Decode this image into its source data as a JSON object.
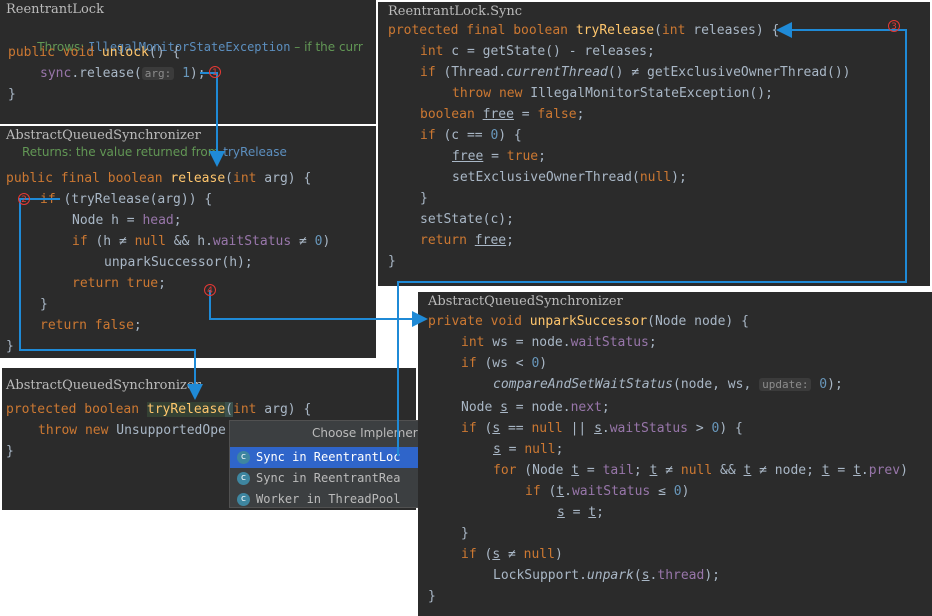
{
  "panels": {
    "unlock": {
      "title": "ReentrantLock",
      "doc": "Throws: IllegalMonitorStateException – if the curr",
      "doc_prefix": "Throws: ",
      "doc_link": "IllegalMonitorStateException",
      "doc_suffix": " – if the curr",
      "sig_kw": "public void ",
      "sig_fn": "unlock",
      "sig_rest": "() {",
      "call_obj": "sync",
      "call_rest": ".release(",
      "hint": "arg:",
      "arg": " 1",
      "call_end": ");",
      "close": "}"
    },
    "release": {
      "title": "AbstractQueuedSynchronizer",
      "doc_text": "Returns: the value returned from ",
      "doc_link": "tryRelease",
      "sig_kw": "public final boolean ",
      "sig_fn": "release",
      "sig_open": "(",
      "sig_type": "int",
      "sig_rest": " arg) {",
      "l1_kw": "if",
      "l1_rest": " (tryRelease(arg)) {",
      "l2": "Node h = ",
      "l2_fld": "head",
      "l2_end": ";",
      "l3_kw": "if",
      "l3_a": " (h ≠ ",
      "l3_null": "null",
      "l3_b": " && h.",
      "l3_fld": "waitStatus",
      "l3_c": " ≠ ",
      "l3_num": "0",
      "l3_d": ")",
      "l4": "unparkSuccessor(h);",
      "l5_kw": "return true",
      "l5_end": ";",
      "l6": "}",
      "l7_kw": "return false",
      "l7_end": ";",
      "close": "}"
    },
    "tryrelease_abs": {
      "title": "AbstractQueuedSynchronizer",
      "sig_kw": "protected boolean ",
      "sig_fn": "tryRelease",
      "sig_open": "(",
      "sig_type": "int",
      "sig_rest": " arg) {",
      "l1_kw": "throw new ",
      "l1_rest": "UnsupportedOpe",
      "close": "}"
    },
    "sync": {
      "title": "ReentrantLock.Sync",
      "sig_kw": "protected final boolean ",
      "sig_fn": "tryRelease",
      "sig_open": "(",
      "sig_type": "int",
      "sig_rest": " releases) {",
      "l1_kw": "int",
      "l1_rest": " c = getState() - releases;",
      "l2_kw": "if",
      "l2_a": " (Thread.",
      "l2_it": "currentThread",
      "l2_b": "() ≠ getExclusiveOwnerThread())",
      "l3_kw": "throw new ",
      "l3_rest": "IllegalMonitorStateException();",
      "l4_kw": "boolean ",
      "l4_var": "free",
      "l4_a": " = ",
      "l4_kw2": "false",
      "l4_end": ";",
      "l5_kw": "if",
      "l5_a": " (c ",
      "l5_op": "==",
      "l5_b": " ",
      "l5_num": "0",
      "l5_c": ") {",
      "l6_var": "free",
      "l6_a": " = ",
      "l6_kw": "true",
      "l6_end": ";",
      "l7": "setExclusiveOwnerThread(",
      "l7_kw": "null",
      "l7_end": ");",
      "l8": "}",
      "l9": "setState(c);",
      "l10_kw": "return ",
      "l10_var": "free",
      "l10_end": ";",
      "close": "}"
    },
    "unpark": {
      "title": "AbstractQueuedSynchronizer",
      "sig_kw": "private void ",
      "sig_fn": "unparkSuccessor",
      "sig_rest": "(Node node) {",
      "l1_kw": "int",
      "l1_a": " ws = node.",
      "l1_fld": "waitStatus",
      "l1_end": ";",
      "l2_kw": "if",
      "l2_a": " (ws < ",
      "l2_num": "0",
      "l2_end": ")",
      "l3_it": "compareAndSetWaitStatus",
      "l3_a": "(node, ws, ",
      "l3_hint": "update:",
      "l3_num": " 0",
      "l3_end": ");",
      "l4_a": "Node ",
      "l4_var": "s",
      "l4_b": " = node.",
      "l4_fld": "next",
      "l4_end": ";",
      "l5_kw": "if",
      "l5_a": " (",
      "l5_var": "s",
      "l5_b": " == ",
      "l5_null": "null",
      "l5_c": " || ",
      "l5_var2": "s",
      "l5_d": ".",
      "l5_fld": "waitStatus",
      "l5_e": " > ",
      "l5_num": "0",
      "l5_f": ") {",
      "l6_var": "s",
      "l6_a": " = ",
      "l6_kw": "null",
      "l6_end": ";",
      "l7_kw": "for",
      "l7_a": " (Node ",
      "l7_t1": "t",
      "l7_b": " = ",
      "l7_fld": "tail",
      "l7_c": "; ",
      "l7_t2": "t",
      "l7_d": " ≠ ",
      "l7_null": "null",
      "l7_e": " && ",
      "l7_t3": "t",
      "l7_f": " ≠ node; ",
      "l7_t4": "t",
      "l7_g": " = ",
      "l7_t5": "t",
      "l7_h": ".",
      "l7_fld2": "prev",
      "l7_i": ")",
      "l8_kw": "if",
      "l8_a": " (",
      "l8_t": "t",
      "l8_b": ".",
      "l8_fld": "waitStatus",
      "l8_c": " ≤ ",
      "l8_num": "0",
      "l8_d": ")",
      "l9_s": "s",
      "l9_a": " = ",
      "l9_t": "t",
      "l9_end": ";",
      "l10": "}",
      "l11_kw": "if",
      "l11_a": " (",
      "l11_s": "s",
      "l11_b": " ≠ ",
      "l11_null": "null",
      "l11_c": ")",
      "l12_a": "LockSupport.",
      "l12_it": "unpark",
      "l12_b": "(",
      "l12_s": "s",
      "l12_c": ".",
      "l12_fld": "thread",
      "l12_end": ");",
      "close": "}"
    }
  },
  "popup": {
    "title": "Choose Implemer",
    "items": [
      "Sync in ReentrantLoc",
      "Sync in ReentrantRea",
      "Worker in ThreadPool"
    ],
    "icon_letter": "c"
  },
  "markers": [
    "1",
    "2",
    "3",
    "4"
  ],
  "colors": {
    "arrow": "#1f8ad6",
    "marker": "#e53935",
    "keyword": "#cc7832",
    "function": "#ffc66d",
    "field": "#9876aa",
    "number": "#6897bb",
    "doc": "#629755"
  }
}
